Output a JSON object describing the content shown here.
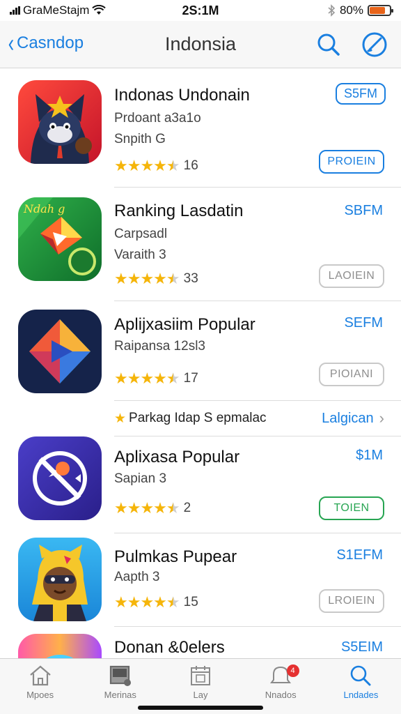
{
  "status_bar": {
    "carrier": "GraMeStajm",
    "time": "2S:1M",
    "battery_percent": "80%",
    "battery_level": 0.8
  },
  "nav": {
    "back_label": "Casndop",
    "title": "Indonsia"
  },
  "apps": [
    {
      "name": "Indonas Undonain",
      "line1": "Prdoant a3a1o",
      "line2": "Snpith G",
      "stars": 4.5,
      "rating_count": "16",
      "price": "S5FM",
      "price_boxed": true,
      "action": "PROIEIN",
      "action_style": "blue"
    },
    {
      "name": "Ranking Lasdatin",
      "line1": "Carpsadl",
      "line2": "Varaith 3",
      "stars": 4.5,
      "rating_count": "33",
      "price": "SBFM",
      "price_boxed": false,
      "action": "LAOIEIN",
      "action_style": "gray"
    },
    {
      "name": "Aplijxasiim Popular",
      "line1": "Raipansa 12sl3",
      "line2": "",
      "stars": 4.5,
      "rating_count": "17",
      "price": "SEFM",
      "price_boxed": false,
      "action": "PIOIANI",
      "action_style": "gray"
    },
    {
      "name": "Aplixasa Popular",
      "line1": "Sapian 3",
      "line2": "",
      "stars": 4.5,
      "rating_count": "2",
      "price": "$1M",
      "price_boxed": false,
      "action": "TOIEN",
      "action_style": "green"
    },
    {
      "name": "Pulmkas Pupear",
      "line1": "Aapth 3",
      "line2": "",
      "stars": 4.5,
      "rating_count": "15",
      "price": "S1EFM",
      "price_boxed": false,
      "action": "LROIEIN",
      "action_style": "gray"
    },
    {
      "name": "Donan &0elers",
      "line1": "",
      "line2": "",
      "stars": 0,
      "rating_count": "",
      "price": "S5EIM",
      "price_boxed": false,
      "action": "",
      "action_style": "gray"
    }
  ],
  "promo": {
    "text": "Parkag  Idap S epmalac",
    "link": "Lalgican"
  },
  "tabs": [
    {
      "label": "Mpoes",
      "icon": "home-icon",
      "active": false
    },
    {
      "label": "Merinas",
      "icon": "gallery-icon",
      "active": false
    },
    {
      "label": "Lay",
      "icon": "calendar-icon",
      "active": false
    },
    {
      "label": "Nnados",
      "icon": "notification-icon",
      "active": false,
      "badge": "4"
    },
    {
      "label": "Lndades",
      "icon": "search-icon",
      "active": true
    }
  ],
  "colors": {
    "accent": "#1a7fe0",
    "star": "#f5b50a",
    "green": "#27a552"
  }
}
